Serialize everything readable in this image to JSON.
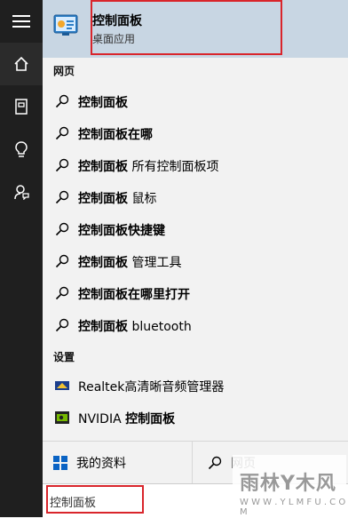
{
  "best_match": {
    "title": "控制面板",
    "subtitle": "桌面应用"
  },
  "sections": {
    "web": "网页",
    "settings": "设置"
  },
  "web_results": [
    {
      "bold": "控制面板",
      "rest": ""
    },
    {
      "bold": "控制面板在哪",
      "rest": ""
    },
    {
      "bold": "控制面板",
      "rest": " 所有控制面板项"
    },
    {
      "bold": "控制面板",
      "rest": " 鼠标"
    },
    {
      "bold": "控制面板快捷键",
      "rest": ""
    },
    {
      "bold": "控制面板",
      "rest": " 管理工具"
    },
    {
      "bold": "控制面板在哪里打开",
      "rest": ""
    },
    {
      "bold": "控制面板",
      "rest": " bluetooth"
    }
  ],
  "settings_results": [
    {
      "label": "Realtek高清晰音频管理器"
    },
    {
      "bold": "NVIDIA ",
      "rest": "控制面板"
    }
  ],
  "bottom": {
    "my_data": "我的资料",
    "web_search": "网页"
  },
  "search": {
    "value": "控制面板"
  },
  "watermark": {
    "title": "雨林Y木风",
    "url": "W W W . Y L M F U . C O M"
  },
  "colors": {
    "rail": "#1f1f1f",
    "highlight": "#c8d6e3",
    "annotation": "#d9252b"
  }
}
